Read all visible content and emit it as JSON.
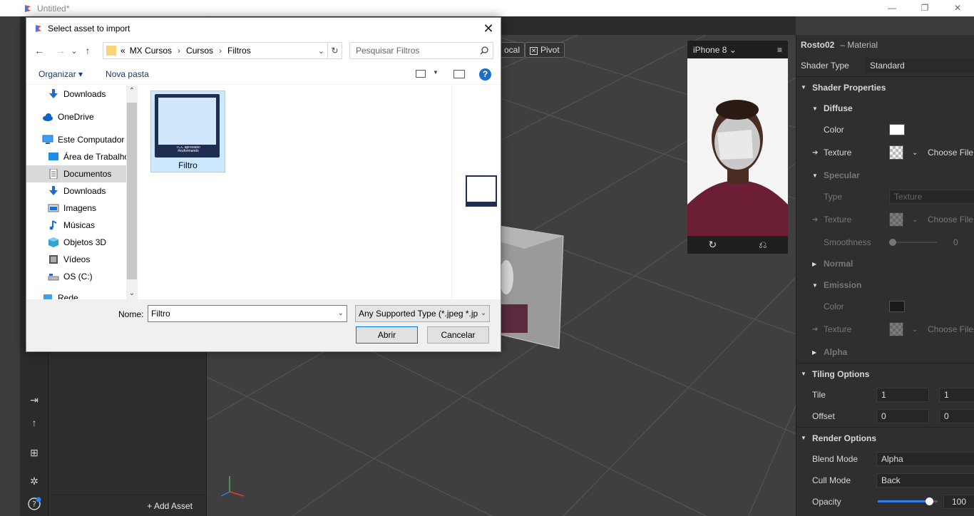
{
  "app": {
    "title": "Untitled*",
    "minimize": "—",
    "restore": "❐",
    "close": "✕"
  },
  "left_panel": {
    "add_asset_label": "+ Add Asset"
  },
  "viewport": {
    "local_label": "ocal",
    "pivot_label": "Pivot"
  },
  "device": {
    "name": "iPhone 8",
    "chevron": "⌄",
    "menu": "≡",
    "rotate_icon": "↻",
    "flip_icon": "⎌"
  },
  "inspector": {
    "object_name": "Rosto02",
    "object_type": "– Material",
    "shader_type_label": "Shader Type",
    "shader_type_value": "Standard",
    "shader_properties": "Shader Properties",
    "diffuse": "Diffuse",
    "color": "Color",
    "texture": "Texture",
    "choose_file": "Choose File...",
    "specular": "Specular",
    "type": "Type",
    "type_value": "Texture",
    "smoothness": "Smoothness",
    "smoothness_value": "0",
    "normal": "Normal",
    "emission": "Emission",
    "alpha": "Alpha",
    "tiling_options": "Tiling Options",
    "tile": "Tile",
    "tile_x": "1",
    "tile_y": "1",
    "offset": "Offset",
    "offset_x": "0",
    "offset_y": "0",
    "render_options": "Render Options",
    "blend_mode": "Blend Mode",
    "blend_mode_value": "Alpha",
    "cull_mode": "Cull Mode",
    "cull_mode_value": "Back",
    "opacity": "Opacity",
    "opacity_value": "100",
    "opacity_fraction": 0.86
  },
  "dialog": {
    "title": "Select asset to import",
    "close": "✕",
    "back": "←",
    "forward": "→",
    "recent": "⌄",
    "up": "↑",
    "breadcrumb_overflow": "«",
    "breadcrumb": [
      "MX Cursos",
      "Cursos",
      "Filtros"
    ],
    "separator": "›",
    "refresh": "↻",
    "search_placeholder": "Pesquisar Filtros",
    "organize": "Organizar ▾",
    "new_folder": "Nova pasta",
    "help": "?",
    "nav_items": [
      {
        "label": "Downloads",
        "icon": "download-icon"
      },
      {
        "label": "OneDrive",
        "icon": "cloud-icon"
      },
      {
        "label": "Este Computador",
        "icon": "computer-icon"
      },
      {
        "label": "Área de Trabalho",
        "icon": "desktop-icon"
      },
      {
        "label": "Documentos",
        "icon": "document-icon"
      },
      {
        "label": "Downloads",
        "icon": "download-icon"
      },
      {
        "label": "Imagens",
        "icon": "pictures-icon"
      },
      {
        "label": "Músicas",
        "icon": "music-icon"
      },
      {
        "label": "Objetos 3D",
        "icon": "cube-icon"
      },
      {
        "label": "Vídeos",
        "icon": "video-icon"
      },
      {
        "label": "OS (C:)",
        "icon": "drive-icon"
      },
      {
        "label": "Rede",
        "icon": "network-icon"
      }
    ],
    "file": {
      "name": "Filtro",
      "caption": "TCC aprovado! #euformando"
    },
    "filename_label": "Nome:",
    "filename_value": "Filtro",
    "filetype": "Any Supported Type (*.jpeg *.jp",
    "open": "Abrir",
    "cancel": "Cancelar"
  }
}
